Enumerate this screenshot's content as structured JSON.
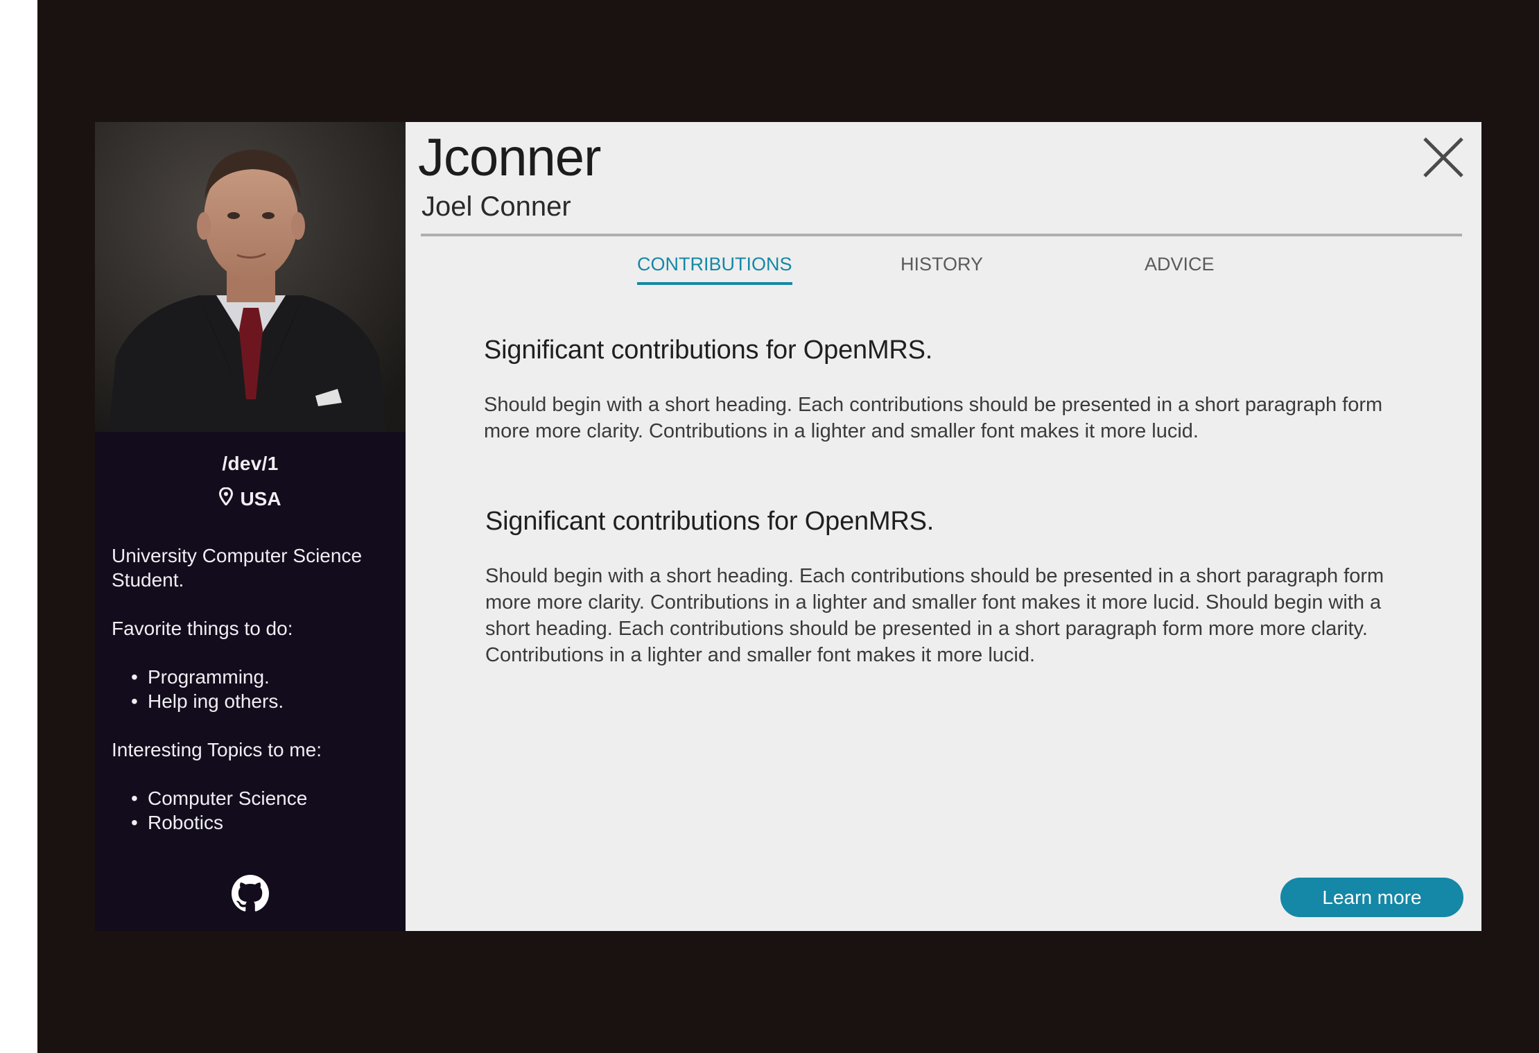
{
  "profile": {
    "username": "Jconner",
    "full_name": "Joel Conner",
    "handle": "/dev/1",
    "location": "USA",
    "bio": {
      "about": "University Computer Science Student.",
      "favorites_heading": "Favorite things to do:",
      "favorites": [
        "Programming.",
        "Help ing others."
      ],
      "topics_heading": "Interesting Topics to me:",
      "topics": [
        "Computer Science",
        "Robotics"
      ]
    }
  },
  "icons": {
    "location": "map-pin-icon",
    "github": "github-icon",
    "close": "close-icon"
  },
  "tabs": [
    {
      "label": "CONTRIBUTIONS",
      "active": true
    },
    {
      "label": "HISTORY",
      "active": false
    },
    {
      "label": "ADVICE",
      "active": false
    }
  ],
  "sections": [
    {
      "heading": "Significant contributions for OpenMRS.",
      "body": "Should begin with a short heading. Each contributions should be presented in a short paragraph form more more clarity. Contributions in a lighter and smaller font makes it more lucid."
    },
    {
      "heading": "Significant contributions for OpenMRS.",
      "body": "Should begin with a short heading. Each contributions should be presented in a short paragraph form more more clarity. Contributions in a lighter and smaller font makes it more lucid. Should begin with a short heading. Each contributions should be presented in a short paragraph form more more clarity. Contributions in a lighter and smaller font makes it more lucid."
    }
  ],
  "actions": {
    "learn_more_label": "Learn more"
  },
  "colors": {
    "backdrop": "#1a1210",
    "sidebar": "#120c1c",
    "panel": "#eeeeee",
    "accent": "#1488a6"
  }
}
